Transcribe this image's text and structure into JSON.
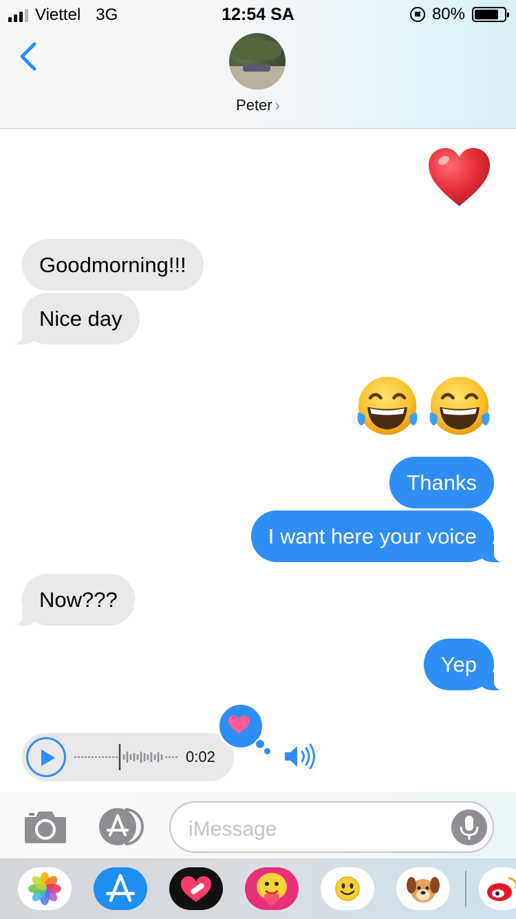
{
  "status_bar": {
    "carrier": "Viettel",
    "network": "3G",
    "time": "12:54 SA",
    "battery": "80%",
    "battery_level": 0.8
  },
  "header": {
    "contact_name": "Peter",
    "back_icon": "chevron-left-icon"
  },
  "messages": [
    {
      "side": "out",
      "kind": "emoji",
      "icon": "red-heart-emoji"
    },
    {
      "side": "in",
      "kind": "text",
      "text": "Goodmorning!!!"
    },
    {
      "side": "in",
      "kind": "text",
      "text": "Nice day"
    },
    {
      "side": "out",
      "kind": "emoji",
      "icon": "face-with-tears-of-joy-emoji"
    },
    {
      "side": "out",
      "kind": "text",
      "text": "Thanks"
    },
    {
      "side": "out",
      "kind": "text",
      "text": "I want here your voice"
    },
    {
      "side": "in",
      "kind": "text",
      "text": "Now???"
    },
    {
      "side": "out",
      "kind": "text",
      "text": "Yep"
    },
    {
      "side": "in",
      "kind": "audio",
      "duration": "0:02",
      "reaction": "heart-icon"
    }
  ],
  "input": {
    "placeholder": "iMessage",
    "camera_icon": "camera-icon",
    "apps_icon": "app-store-icon",
    "mic_icon": "microphone-icon"
  },
  "app_drawer": {
    "apps": [
      "photos-icon",
      "app-store-icon",
      "digital-touch-heart-icon",
      "sticker-pack-icon",
      "emoji-smiley-icon",
      "puppy-sticker-icon",
      "weibo-icon"
    ]
  },
  "colors": {
    "accent": "#2e8ef5",
    "incoming_bubble": "#e9e9eb",
    "heart": "#e8303b"
  }
}
